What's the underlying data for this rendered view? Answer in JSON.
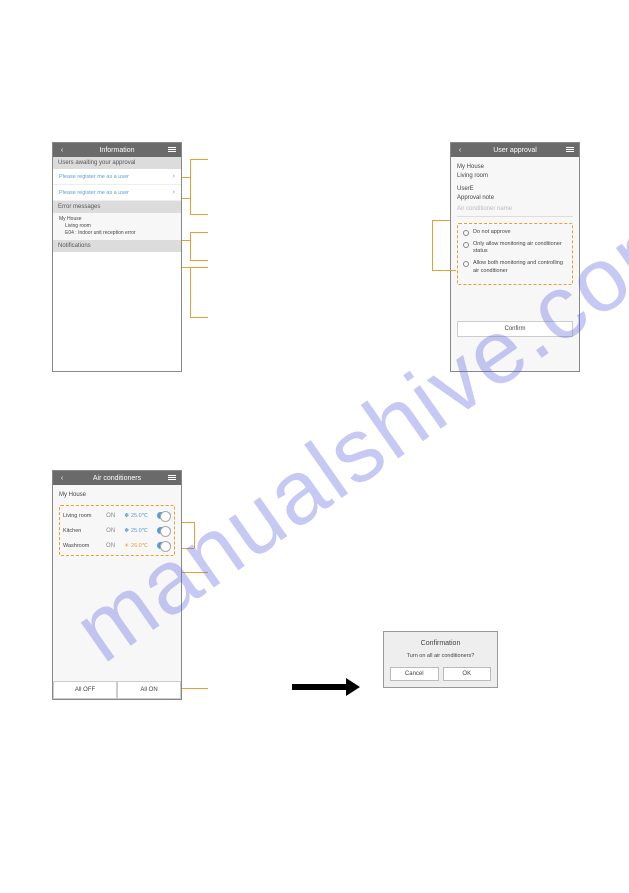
{
  "watermark": "manualshive.com",
  "phone1": {
    "title": "Information",
    "sections": {
      "approval_head": "Users awaiting your approval",
      "approval_rows": [
        "Please register me as a user",
        "Please register me as a user"
      ],
      "errors_head": "Error messages",
      "err_house": "My House",
      "err_room": "Living room",
      "err_msg": "E04 : Indoor unit reception error",
      "notif_head": "Notifications"
    }
  },
  "phone2": {
    "title": "User approval",
    "house": "My House",
    "room": "Living room",
    "user": "UserE",
    "note_label": "Approval note",
    "placeholder": "Air conditioner name",
    "opts": [
      "Do not approve",
      "Only allow monitoring air conditioner status",
      "Allow both monitoring and controlling air conditioner"
    ],
    "confirm": "Confirm"
  },
  "phone3": {
    "title": "Air conditioners",
    "house": "My House",
    "rooms": [
      {
        "name": "Living room",
        "state": "ON",
        "temp": "25.0℃",
        "warm": false
      },
      {
        "name": "Kitchen",
        "state": "ON",
        "temp": "25.0℃",
        "warm": false
      },
      {
        "name": "Washroom",
        "state": "ON",
        "temp": "26.0℃",
        "warm": true
      }
    ],
    "all_off": "All OFF",
    "all_on": "All ON"
  },
  "dialog": {
    "title": "Confirmation",
    "msg": "Turn on all air conditioners?",
    "cancel": "Cancel",
    "ok": "OK"
  }
}
